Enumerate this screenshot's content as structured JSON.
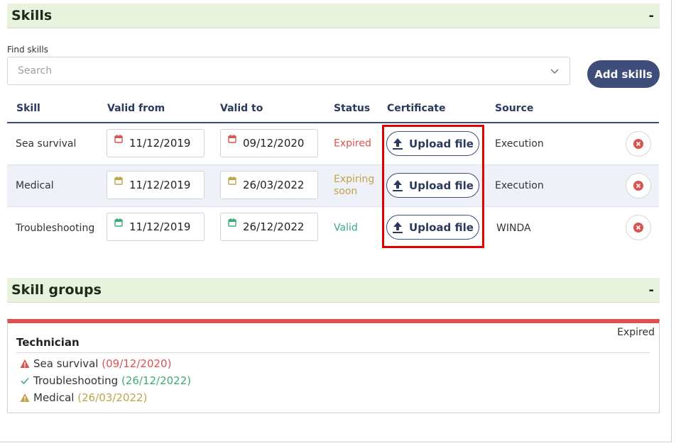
{
  "skills_section": {
    "title": "Skills",
    "collapse": "-"
  },
  "find": {
    "label": "Find skills",
    "placeholder": "Search",
    "add_label": "Add skills"
  },
  "columns": [
    "Skill",
    "Valid from",
    "Valid to",
    "Status",
    "Certificate",
    "Source"
  ],
  "rows": [
    {
      "skill": "Sea survival",
      "valid_from": "11/12/2019",
      "valid_to": "09/12/2020",
      "status": "Expired",
      "status_color": "#d9534f",
      "certificate": "Upload file",
      "source": "Execution"
    },
    {
      "skill": "Medical",
      "valid_from": "11/12/2019",
      "valid_to": "26/03/2022",
      "status": "Expiring soon",
      "status_color": "#c4a24a",
      "certificate": "Upload file",
      "source": "Execution"
    },
    {
      "skill": "Troubleshooting",
      "valid_from": "11/12/2019",
      "valid_to": "26/12/2022",
      "status": "Valid",
      "status_color": "#3cab79",
      "certificate": "Upload file",
      "source": "WINDA"
    }
  ],
  "skill_groups_section": {
    "title": "Skill groups",
    "collapse": "-"
  },
  "group": {
    "status": "Expired",
    "status_color": "#d9534f",
    "name": "Technician",
    "items": [
      {
        "name": "Sea survival",
        "date": "(09/12/2020)",
        "icon": "warning-icon",
        "color": "#d9534f"
      },
      {
        "name": "Troubleshooting",
        "date": "(26/12/2022)",
        "icon": "check-icon",
        "color": "#3cab79"
      },
      {
        "name": "Medical",
        "date": "(26/03/2022)",
        "icon": "warning-icon",
        "color": "#c4a24a"
      }
    ]
  }
}
